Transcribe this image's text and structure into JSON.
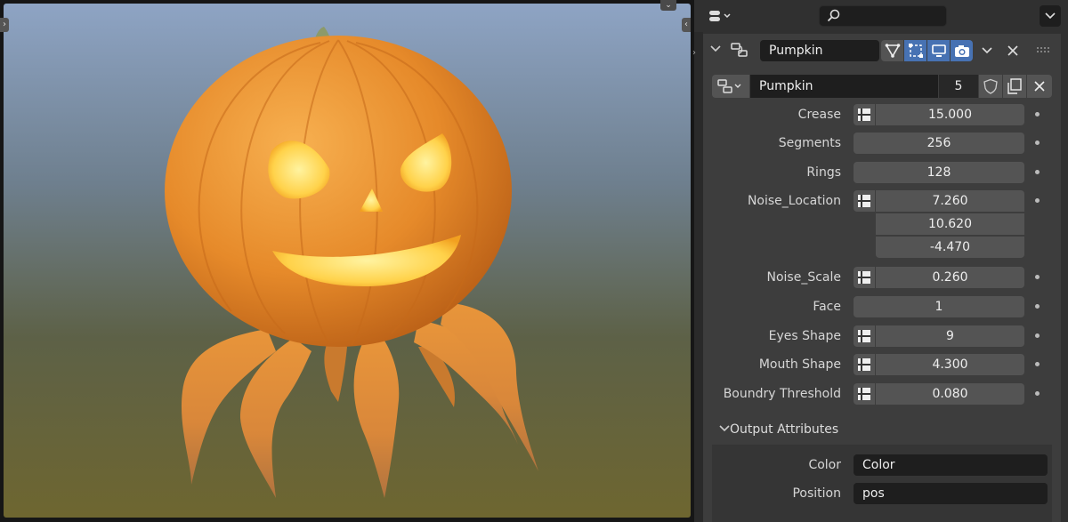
{
  "header": {
    "search_placeholder": ""
  },
  "modifier": {
    "name": "Pumpkin"
  },
  "node_group": {
    "name": "Pumpkin",
    "users": "5"
  },
  "properties": [
    {
      "label": "Crease",
      "value": "15.000",
      "animatable": true
    },
    {
      "label": "Segments",
      "value": "256",
      "animatable": false
    },
    {
      "label": "Rings",
      "value": "128",
      "animatable": false
    },
    {
      "label": "Noise_Location",
      "values": [
        "7.260",
        "10.620",
        "-4.470"
      ],
      "animatable": true
    },
    {
      "label": "Noise_Scale",
      "value": "0.260",
      "animatable": true
    },
    {
      "label": "Face",
      "value": "1",
      "animatable": false
    },
    {
      "label": "Eyes Shape",
      "value": "9",
      "animatable": true
    },
    {
      "label": "Mouth Shape",
      "value": "4.300",
      "animatable": true
    },
    {
      "label": "Boundry Threshold",
      "value": "0.080",
      "animatable": true
    }
  ],
  "output_attributes": {
    "title": "Output Attributes",
    "color_label": "Color",
    "color_value": "Color",
    "position_label": "Position",
    "position_value": "pos"
  },
  "colors": {
    "panel_bg": "#3d3d3d",
    "field_bg": "#545454",
    "text_field_bg": "#1e1e1e",
    "active_toggle": "#4772b3",
    "pumpkin": "#e8902a",
    "glow": "#ffd24a"
  }
}
